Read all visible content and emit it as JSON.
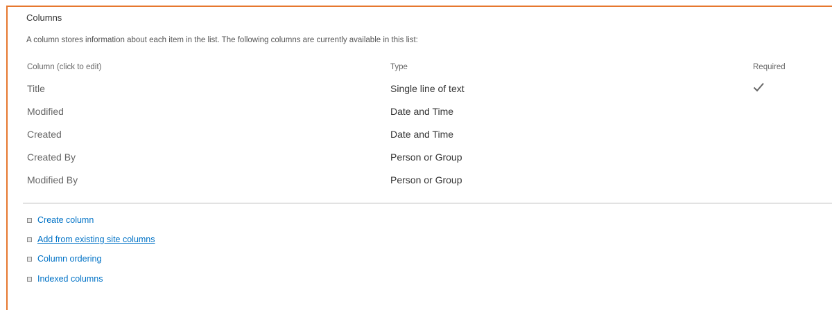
{
  "section": {
    "title": "Columns",
    "description": "A column stores information about each item in the list. The following columns are currently available in this list:"
  },
  "table": {
    "headers": {
      "column": "Column (click to edit)",
      "type": "Type",
      "required": "Required"
    },
    "rows": [
      {
        "name": "Title",
        "type": "Single line of text",
        "required": true
      },
      {
        "name": "Modified",
        "type": "Date and Time",
        "required": false
      },
      {
        "name": "Created",
        "type": "Date and Time",
        "required": false
      },
      {
        "name": "Created By",
        "type": "Person or Group",
        "required": false
      },
      {
        "name": "Modified By",
        "type": "Person or Group",
        "required": false
      }
    ]
  },
  "links": [
    {
      "label": "Create column"
    },
    {
      "label": "Add from existing site columns"
    },
    {
      "label": "Column ordering"
    },
    {
      "label": "Indexed columns"
    }
  ],
  "colors": {
    "accent_border": "#e6772e",
    "link": "#0072c6"
  }
}
